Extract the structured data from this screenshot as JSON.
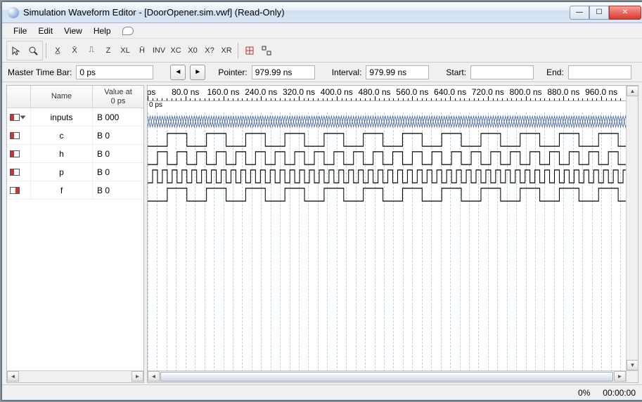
{
  "window": {
    "title": "Simulation Waveform Editor - [DoorOpener.sim.vwf] (Read-Only)"
  },
  "menu": {
    "file": "File",
    "edit": "Edit",
    "view": "View",
    "help": "Help"
  },
  "toolbar": {
    "pointer": "pointer",
    "zoom": "zoom",
    "sep1": "|",
    "t1": "X̲",
    "t2": "X̄",
    "t3": "⎍",
    "t4": "Z",
    "t5": "XL",
    "t6": "H̄",
    "t7": "INV",
    "t8": "XC",
    "t9": "X0",
    "t10": "X?",
    "t11": "XR",
    "t12": "grid",
    "t13": "snaps"
  },
  "timebar": {
    "masterLabel": "Master Time Bar:",
    "masterValue": "0 ps",
    "pointerLabel": "Pointer:",
    "pointerValue": "979.99 ns",
    "intervalLabel": "Interval:",
    "intervalValue": "979.99 ns",
    "startLabel": "Start:",
    "startValue": "",
    "endLabel": "End:",
    "endValue": ""
  },
  "grid": {
    "hdr": {
      "name": "Name",
      "value": "Value at\n0 ps"
    },
    "rows": [
      {
        "type": "in",
        "expand": true,
        "name": "inputs",
        "value": "B 000"
      },
      {
        "type": "in",
        "expand": false,
        "name": "c",
        "value": "B 0"
      },
      {
        "type": "in",
        "expand": false,
        "name": "h",
        "value": "B 0"
      },
      {
        "type": "in",
        "expand": false,
        "name": "p",
        "value": "B 0"
      },
      {
        "type": "out",
        "expand": false,
        "name": "f",
        "value": "B 0"
      }
    ]
  },
  "ruler": {
    "psLabel": "0 ps",
    "labels": [
      "0 ps",
      "80.0 ns",
      "160.0 ns",
      "240.0 ns",
      "320.0 ns",
      "400.0 ns",
      "480.0 ns",
      "560.0 ns",
      "640.0 ns",
      "720.0 ns",
      "800.0 ns",
      "880.0 ns",
      "960.0 ns"
    ]
  },
  "status": {
    "percent": "0%",
    "time": "00:00:00"
  },
  "chart_data": {
    "type": "waveform",
    "time_range_ns": [
      0,
      1000
    ],
    "visible_grid_spacing_ns": 40,
    "signals": [
      {
        "name": "inputs",
        "kind": "bus",
        "bits": 3,
        "transition_period_ns": 10,
        "initial": "000"
      },
      {
        "name": "c",
        "kind": "bit",
        "period_ns": 80,
        "duty": 0.5,
        "initial": 0
      },
      {
        "name": "h",
        "kind": "bit",
        "period_ns": 40,
        "duty": 0.5,
        "initial": 0
      },
      {
        "name": "p",
        "kind": "bit",
        "period_ns": 20,
        "duty": 0.5,
        "initial": 0
      },
      {
        "name": "f",
        "kind": "bit",
        "period_ns": 80,
        "duty": 0.5,
        "phase_ns": 0,
        "initial": 0
      }
    ]
  }
}
